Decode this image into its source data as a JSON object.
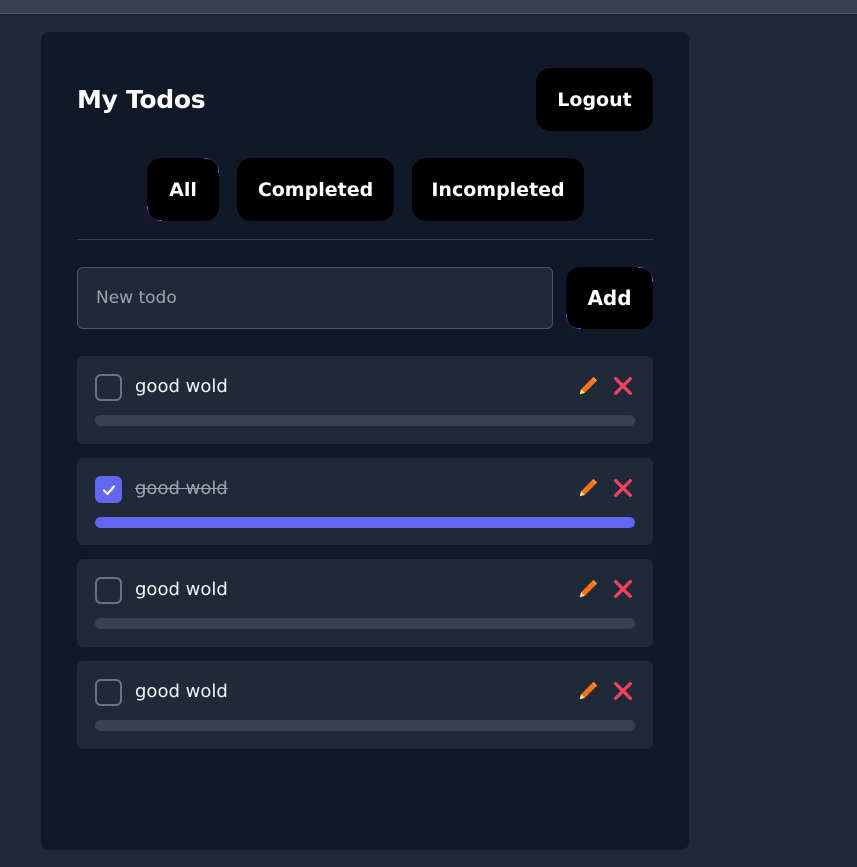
{
  "header": {
    "title": "My Todos",
    "logout_label": "Logout"
  },
  "filters": [
    {
      "label": "All",
      "active": true
    },
    {
      "label": "Completed",
      "active": false
    },
    {
      "label": "Incompleted",
      "active": false
    }
  ],
  "new_todo": {
    "placeholder": "New todo",
    "value": "",
    "add_label": "Add"
  },
  "todos": [
    {
      "text": "good wold",
      "completed": false,
      "progress": 0
    },
    {
      "text": "good wold",
      "completed": true,
      "progress": 100
    },
    {
      "text": "good wold",
      "completed": false,
      "progress": 0
    },
    {
      "text": "good wold",
      "completed": false,
      "progress": 0
    }
  ],
  "icons": {
    "edit": "pencil-icon",
    "delete": "close-icon",
    "check": "check-icon"
  },
  "colors": {
    "accent": "#6366f1",
    "glow": "#9333ea",
    "edit_icon": "#f97316",
    "delete_icon": "#f43f5e",
    "card_bg": "#111827",
    "page_bg": "#1f2937"
  }
}
